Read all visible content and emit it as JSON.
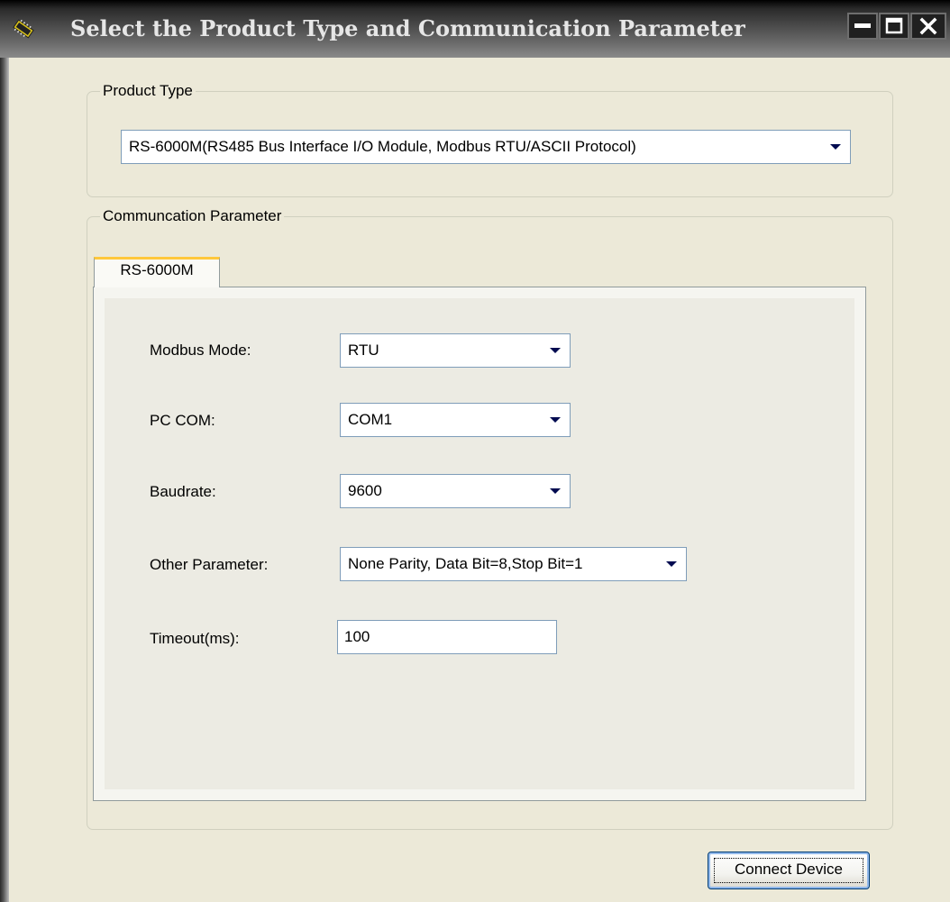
{
  "window": {
    "title": "Select the Product Type and Communication  Parameter",
    "icon": "chip-icon",
    "controls": [
      "minimize",
      "maximize",
      "close"
    ]
  },
  "product_group": {
    "legend": "Product Type",
    "selected": "RS-6000M(RS485 Bus Interface I/O Module, Modbus RTU/ASCII Protocol)"
  },
  "comm_group": {
    "legend": "Communcation Parameter",
    "tab_label": "RS-6000M",
    "fields": {
      "modbus_mode": {
        "label": "Modbus Mode:",
        "value": "RTU"
      },
      "pc_com": {
        "label": "PC COM:",
        "value": "COM1"
      },
      "baudrate": {
        "label": "Baudrate:",
        "value": "9600"
      },
      "other_parameter": {
        "label": "Other Parameter:",
        "value": "None Parity, Data Bit=8,Stop Bit=1"
      },
      "timeout": {
        "label": "Timeout(ms):",
        "value": "100"
      }
    }
  },
  "actions": {
    "connect_label": "Connect Device"
  },
  "colors": {
    "title_text": "#e6e6e6",
    "dialog_bg": "#ece9d8",
    "input_border": "#7f9db9",
    "tab_highlight": "#ffc83c",
    "dropdown_arrow": "#000a50"
  }
}
